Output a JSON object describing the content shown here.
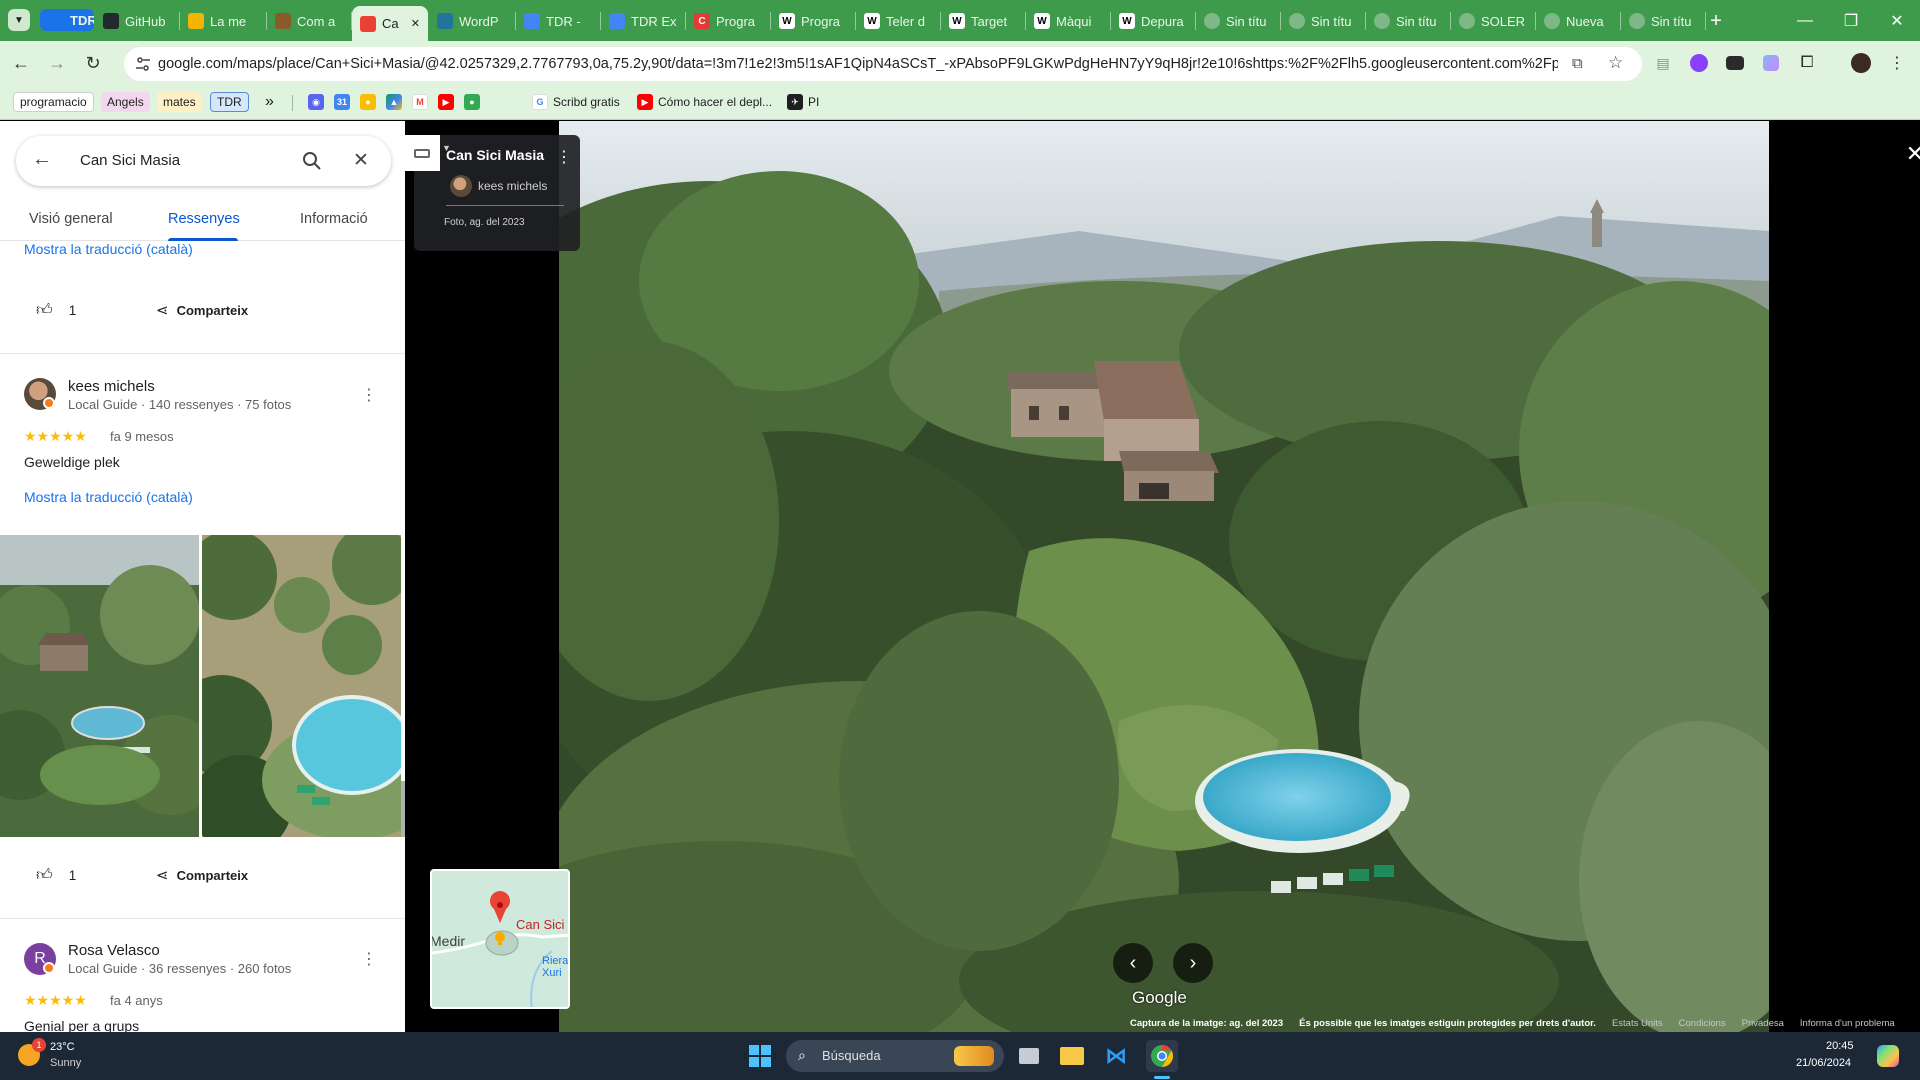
{
  "browser": {
    "tabs": [
      {
        "label": "TDR",
        "favicon": "tdr-icon",
        "color": "#1a73e8"
      },
      {
        "label": "GitHub",
        "favicon": "github-icon",
        "color": "#24292f"
      },
      {
        "label": "La me",
        "favicon": "drive-icon",
        "color": "#f4b400"
      },
      {
        "label": "Com a",
        "favicon": "image-icon",
        "color": "#8a5a2b"
      },
      {
        "label": "Ca",
        "favicon": "maps-pin-icon",
        "color": "#ea4335",
        "active": true
      },
      {
        "label": "WordP",
        "favicon": "wordpress-icon",
        "color": "#21759b"
      },
      {
        "label": "TDR - ",
        "favicon": "docs-icon",
        "color": "#4285f4"
      },
      {
        "label": "TDR Ex",
        "favicon": "docs-icon",
        "color": "#4285f4"
      },
      {
        "label": "Progra",
        "favicon": "c-icon",
        "color": "#e53935"
      },
      {
        "label": "Progra",
        "favicon": "wikipedia-icon",
        "color": "#ffffff"
      },
      {
        "label": "Teler d",
        "favicon": "wikipedia-icon",
        "color": "#ffffff"
      },
      {
        "label": "Target",
        "favicon": "wikipedia-icon",
        "color": "#ffffff"
      },
      {
        "label": "Màqui",
        "favicon": "wikipedia-icon",
        "color": "#ffffff"
      },
      {
        "label": "Depura",
        "favicon": "wikipedia-icon",
        "color": "#ffffff"
      },
      {
        "label": "Sin títu",
        "favicon": "blank-icon",
        "color": "#7fb887"
      },
      {
        "label": "Sin títu",
        "favicon": "blank-icon",
        "color": "#7fb887"
      },
      {
        "label": "Sin títu",
        "favicon": "blank-icon",
        "color": "#7fb887"
      },
      {
        "label": "SOLER",
        "favicon": "blank-icon",
        "color": "#7fb887"
      },
      {
        "label": "Nueva",
        "favicon": "blank-icon",
        "color": "#7fb887"
      },
      {
        "label": "Sin títu",
        "favicon": "blank-icon",
        "color": "#7fb887"
      }
    ],
    "new_tab": "+",
    "url": "google.com/maps/place/Can+Sici+Masia/@42.0257329,2.7767793,0a,75.2y,90t/data=!3m7!1e2!3m5!1sAF1QipN4aSCsT_-xPAbsoPF9LGKwPdgHeHN7yY9qH8jr!2e10!6shttps:%2F%2Flh5.googleusercontent.com%2Fp%2FAF1QipN...",
    "bookmarks": [
      {
        "label": "programacio",
        "type": "chip",
        "bg": "#ffffff"
      },
      {
        "label": "Angels",
        "type": "chip",
        "bg": "#f3d7ee"
      },
      {
        "label": "mates",
        "type": "chip",
        "bg": "#fdf0c4"
      },
      {
        "label": "TDR",
        "type": "chip",
        "bg": "#d6e6fb"
      }
    ],
    "bookmark_more": "»",
    "bookmark_links": [
      {
        "label": "Scribd gratis",
        "icon": "google-icon"
      },
      {
        "label": "Cómo hacer el depl...",
        "icon": "youtube-icon"
      },
      {
        "label": "PI",
        "icon": "pin-icon"
      }
    ]
  },
  "panel": {
    "search_value": "Can Sici Masia",
    "tabs": [
      "Visió general",
      "Ressenyes",
      "Informació"
    ],
    "selected_tab": 1,
    "translate_link": "Mostra la traducció (català)",
    "share_label": "Comparteix",
    "reviews": [
      {
        "likes": "1",
        "name": "kees michels",
        "meta": "Local Guide · 140 ressenyes · 75 fotos",
        "stars": "★★★★★",
        "when": "fa 9 mesos",
        "text": "Geweldige plek",
        "translate": "Mostra la traducció (català)",
        "avatar_color": "#8b6a4f",
        "likes2": "1"
      },
      {
        "name": "Rosa Velasco",
        "initial": "R",
        "meta": "Local Guide · 36 ressenyes · 260 fotos",
        "stars": "★★★★★",
        "when": "fa 4 anys",
        "text": "Genial per a grups",
        "avatar_color": "#7b3fa0"
      }
    ]
  },
  "viewer": {
    "place_title": "Can Sici Masia",
    "author": "kees michels",
    "photo_date": "Foto, ag. del 2023",
    "minimap_place": "Can Sici",
    "minimap_town": "Medir",
    "minimap_river": "Riera Xuri",
    "watermark": "Google",
    "footer": {
      "capture": "Captura de la imatge: ag. del 2023",
      "rights": "És possible que les imatges estiguin protegides per drets d'autor.",
      "country": "Estats Units",
      "terms": "Condicions",
      "privacy": "Privadesa",
      "report": "Informa d'un problema"
    }
  },
  "taskbar": {
    "weather_temp": "23°C",
    "weather_desc": "Sunny",
    "weather_badge": "1",
    "search_label": "Búsqueda",
    "time": "20:45",
    "date": "21/06/2024"
  }
}
